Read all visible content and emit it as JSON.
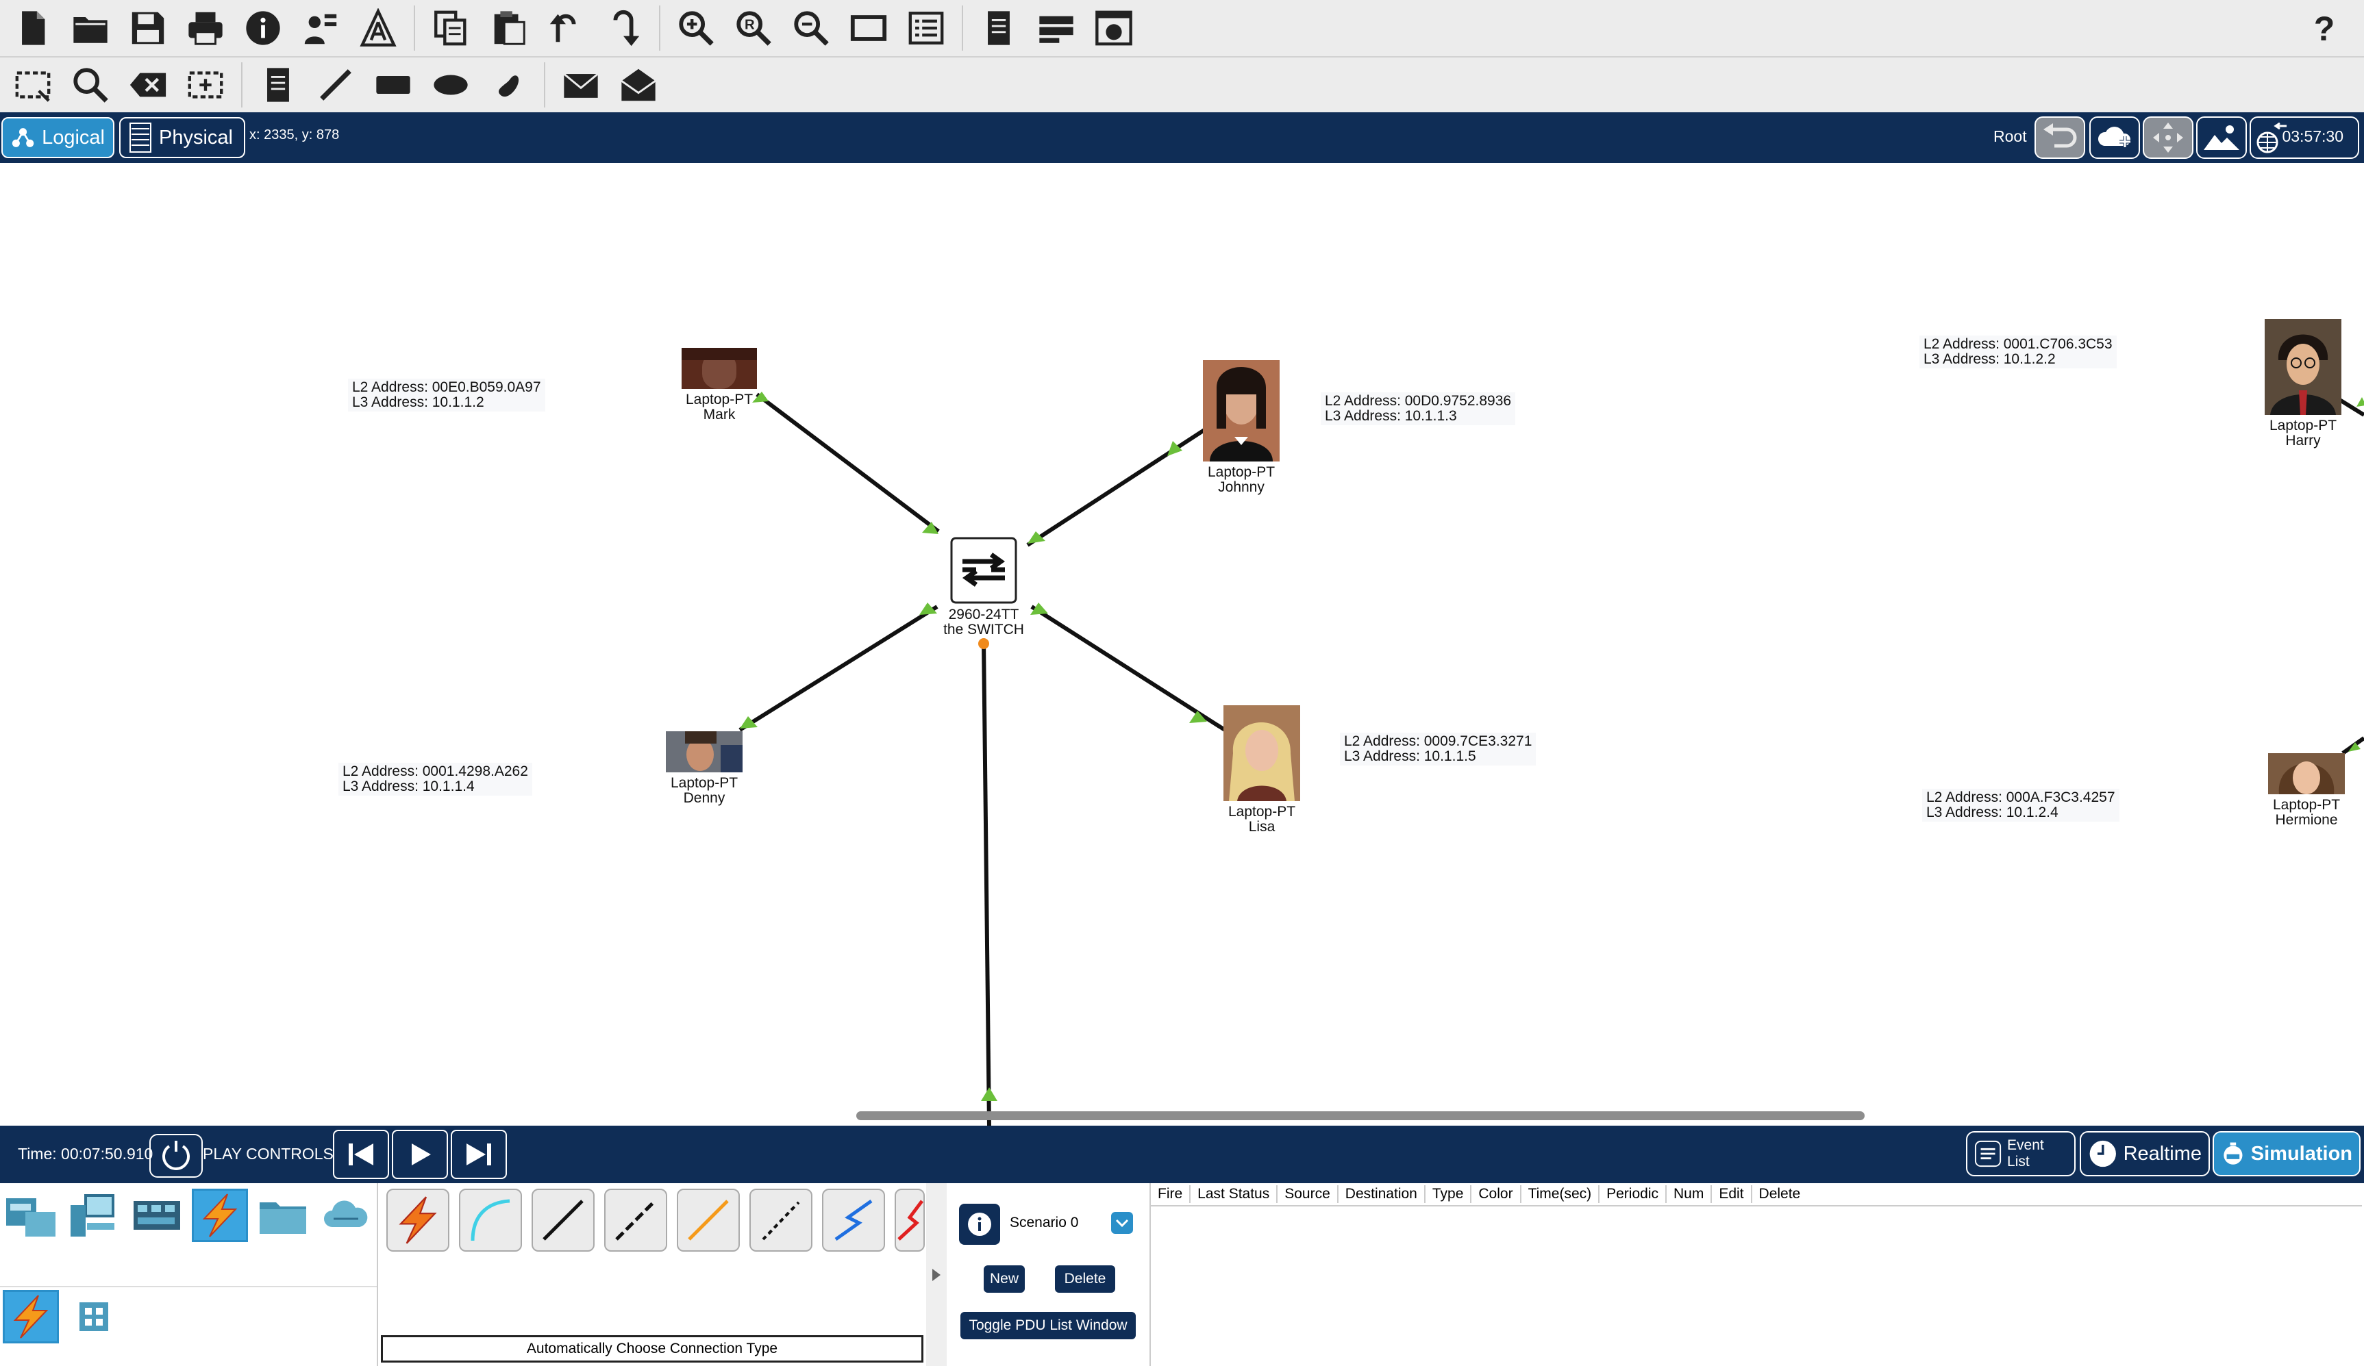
{
  "toolbar_top": {
    "icons": [
      "new-file-icon",
      "open-folder-icon",
      "save-icon",
      "print-icon",
      "info-icon",
      "activity-wizard-icon",
      "triangle-a-icon",
      "copy-icon",
      "paste-icon",
      "undo-icon",
      "redo-icon",
      "zoom-in-icon",
      "zoom-reset-icon",
      "zoom-out-icon",
      "drawing-palette-icon",
      "custom-devices-icon",
      "notes-icon",
      "cluster-icon",
      "pdu-capture-icon"
    ],
    "help_label": "?"
  },
  "toolbar_second": {
    "icons": [
      "select-icon",
      "inspect-icon",
      "delete-icon",
      "resize-icon",
      "note-icon",
      "line-draw-icon",
      "rectangle-icon",
      "ellipse-icon",
      "freeform-icon",
      "simple-pdu-icon",
      "complex-pdu-icon"
    ]
  },
  "nav": {
    "logical_label": "Logical",
    "physical_label": "Physical",
    "coords": "x: 2335, y: 878",
    "root_label": "Root",
    "time": "03:57:30",
    "buttons": [
      "back-icon",
      "new-cluster-icon",
      "move-icon",
      "set-background-icon",
      "viewport-icon"
    ]
  },
  "devices": {
    "mark": {
      "model": "Laptop-PT",
      "name": "Mark",
      "l2": "L2 Address: 00E0.B059.0A97",
      "l3": "L3 Address: 10.1.1.2"
    },
    "johnny": {
      "model": "Laptop-PT",
      "name": "Johnny",
      "l2": "L2 Address: 00D0.9752.8936",
      "l3": "L3 Address: 10.1.1.3"
    },
    "denny": {
      "model": "Laptop-PT",
      "name": "Denny",
      "l2": "L2 Address: 0001.4298.A262",
      "l3": "L3 Address: 10.1.1.4"
    },
    "lisa": {
      "model": "Laptop-PT",
      "name": "Lisa",
      "l2": "L2 Address: 0009.7CE3.3271",
      "l3": "L3 Address: 10.1.1.5"
    },
    "harry": {
      "model": "Laptop-PT",
      "name": "Harry",
      "l2": "L2 Address: 0001.C706.3C53",
      "l3": "L3 Address: 10.1.2.2"
    },
    "hermione": {
      "model": "Laptop-PT",
      "name": "Hermione",
      "l2": "L2 Address: 000A.F3C3.4257",
      "l3": "L3 Address: 10.1.2.4"
    },
    "switch": {
      "model": "2960-24TT",
      "name": "the SWITCH"
    }
  },
  "controls": {
    "time_label": "Time: 00:07:50.910",
    "play_label": "PLAY CONTROLS:",
    "event_list_label": "Event List",
    "realtime_label": "Realtime",
    "simulation_label": "Simulation"
  },
  "bottom": {
    "auto_connection_label": "Automatically Choose Connection Type",
    "scenario_label": "Scenario 0",
    "new_label": "New",
    "delete_label": "Delete",
    "toggle_label": "Toggle PDU List Window",
    "pdu_columns": [
      "Fire",
      "Last Status",
      "Source",
      "Destination",
      "Type",
      "Color",
      "Time(sec)",
      "Periodic",
      "Num",
      "Edit",
      "Delete"
    ]
  },
  "colors": {
    "nav_bg": "#0f2d56",
    "accent": "#2a8fc9",
    "link_up": "#6bbf3a",
    "link_pending": "#f08a1c"
  }
}
